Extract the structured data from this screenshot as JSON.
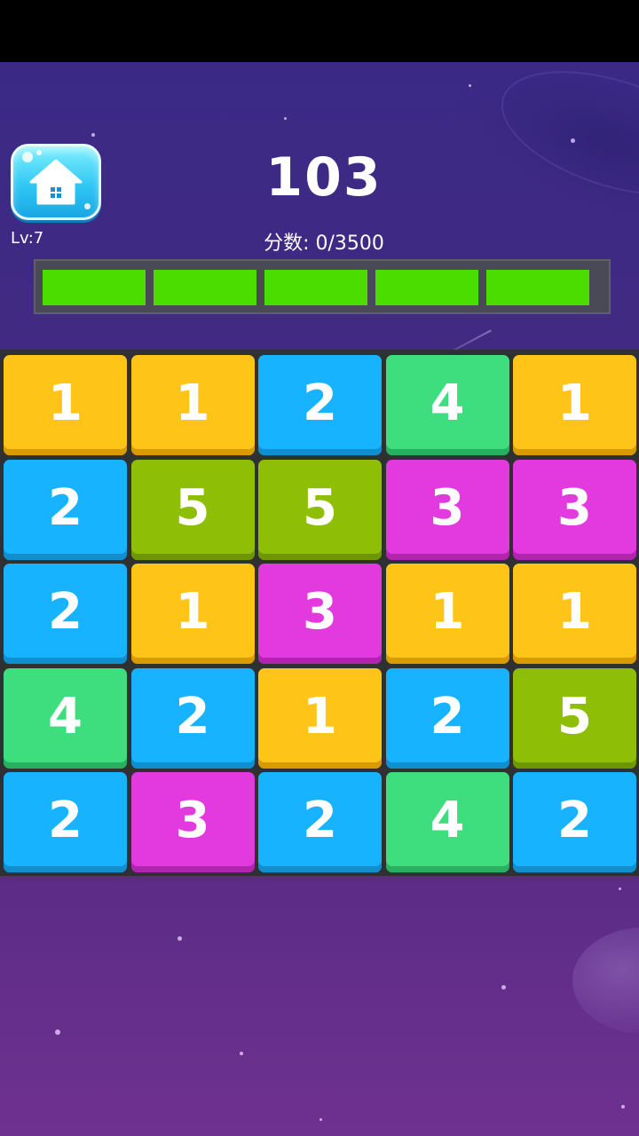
{
  "hud": {
    "level": "Lv:7",
    "moves": "103",
    "score": "分数: 0/3500",
    "progress_segments_filled": 5,
    "progress_segments_total": 5
  },
  "icons": {
    "home": "home-icon"
  },
  "colors": {
    "tile_1": "#fec418",
    "tile_2": "#18b3fe",
    "tile_3": "#e33ae0",
    "tile_4": "#3ede7f",
    "tile_5": "#8ebe05",
    "progress_fill": "#4bdc00"
  },
  "board": {
    "rows": [
      [
        "1",
        "1",
        "2",
        "4",
        "1"
      ],
      [
        "2",
        "5",
        "5",
        "3",
        "3"
      ],
      [
        "2",
        "1",
        "3",
        "1",
        "1"
      ],
      [
        "4",
        "2",
        "1",
        "2",
        "5"
      ],
      [
        "2",
        "3",
        "2",
        "4",
        "2"
      ]
    ]
  }
}
